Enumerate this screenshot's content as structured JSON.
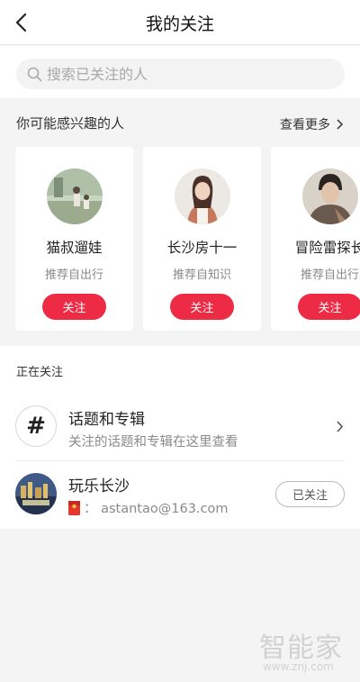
{
  "header": {
    "title": "我的关注"
  },
  "search": {
    "placeholder": "搜索已关注的人"
  },
  "recommend": {
    "title": "你可能感兴趣的人",
    "more_label": "查看更多",
    "cards": [
      {
        "name": "猫叔遛娃",
        "source": "推荐自出行",
        "follow_label": "关注"
      },
      {
        "name": "长沙房十一",
        "source": "推荐自知识",
        "follow_label": "关注"
      },
      {
        "name": "冒险雷探长",
        "source": "推荐自出行",
        "follow_label": "关注"
      }
    ]
  },
  "following": {
    "title": "正在关注",
    "topics": {
      "icon_glyph": "#",
      "title": "话题和专辑",
      "subtitle": "关注的话题和专辑在这里查看"
    },
    "items": [
      {
        "name": "玩乐长沙",
        "account": "：  astantao@163.com",
        "followed_label": "已关注"
      }
    ]
  },
  "watermark": {
    "text": "智能家",
    "url": "www.znj.com"
  },
  "colors": {
    "accent": "#ee2b45",
    "background": "#f4f4f4"
  }
}
